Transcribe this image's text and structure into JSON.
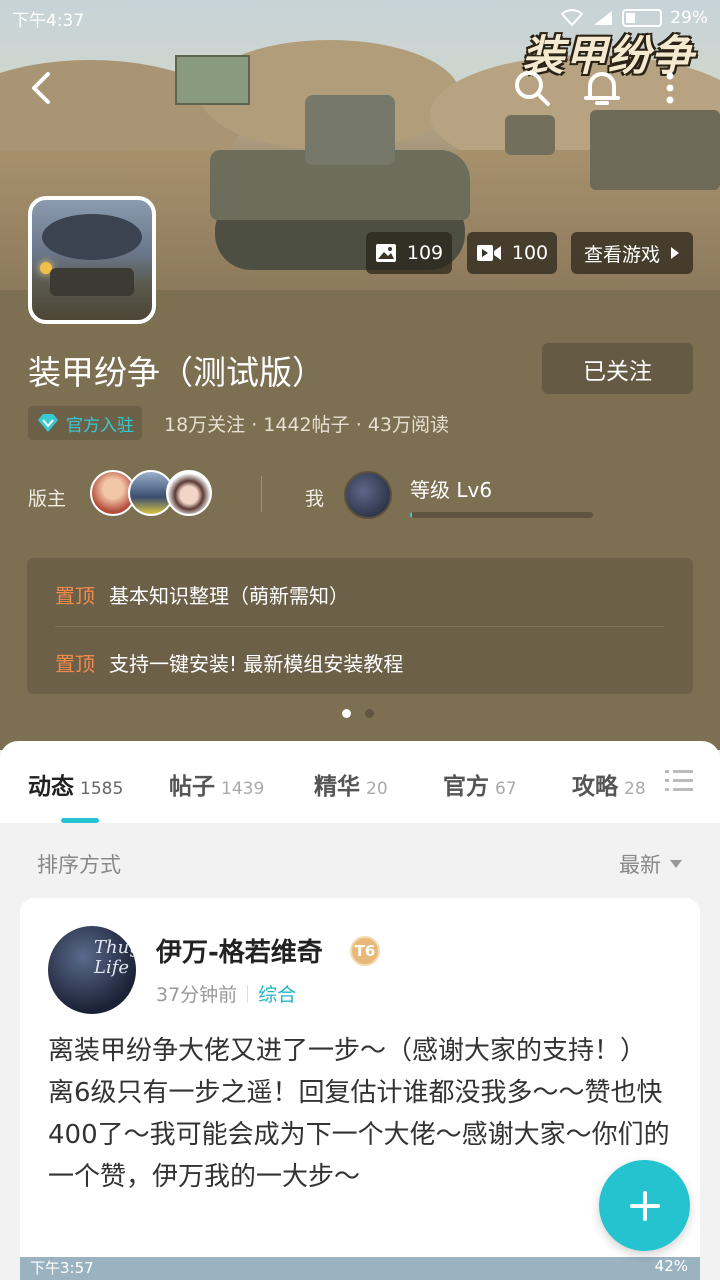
{
  "status_bar": {
    "time": "下午4:37",
    "battery": "29%"
  },
  "header": {
    "game_logo": "装甲纷争",
    "photo_count": "109",
    "video_count": "100",
    "view_game_label": "查看游戏"
  },
  "forum": {
    "title": "装甲纷争（测试版）",
    "follow_label": "已关注",
    "official_badge": "官方入驻",
    "stats": "18万关注 · 1442帖子 · 43万阅读",
    "moderators_label": "版主",
    "me_label": "我",
    "level_label": "等级 Lv6",
    "level_progress": 0.01
  },
  "pinned": {
    "items": [
      {
        "tag": "置顶",
        "title": "基本知识整理（萌新需知）"
      },
      {
        "tag": "置顶",
        "title": "支持一键安装! 最新模组安装教程"
      }
    ]
  },
  "tabs": [
    {
      "label": "动态",
      "count": "1585"
    },
    {
      "label": "帖子",
      "count": "1439"
    },
    {
      "label": "精华",
      "count": "20"
    },
    {
      "label": "官方",
      "count": "67"
    },
    {
      "label": "攻略",
      "count": "28"
    }
  ],
  "sort": {
    "label": "排序方式",
    "value": "最新"
  },
  "post": {
    "author": "伊万-格若维奇",
    "avatar_text": "Thug Life",
    "badge": "T6",
    "time": "37分钟前",
    "category": "综合",
    "body": "离装甲纷争大佬又进了一步～（感谢大家的支持！）\n离6级只有一步之遥！回复估计谁都没我多～～赞也快400了～我可能会成为下一个大佬～感谢大家～你们的一个赞，伊万我的一大步～"
  },
  "embedded_screenshot": {
    "time": "下午3:57",
    "battery": "42%"
  },
  "colors": {
    "accent": "#25c3cf",
    "brown": "#7d6f52",
    "pinned_tag": "#f08a4b"
  }
}
